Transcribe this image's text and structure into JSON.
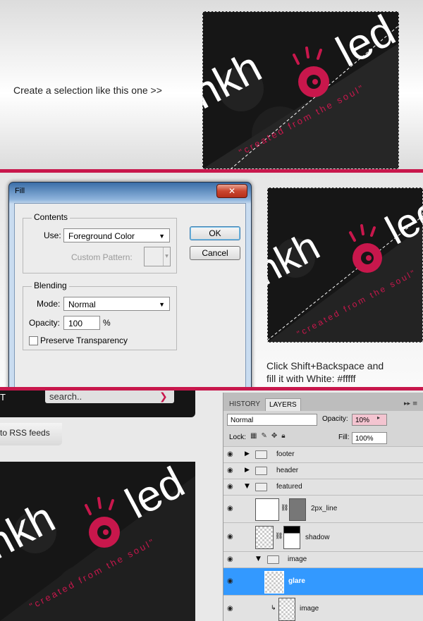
{
  "step1": {
    "instruction": "Create a selection like this one >>"
  },
  "logo": {
    "wordmark_left": "nkh",
    "wordmark_right": "led",
    "tagline": "\"created from the soul\"",
    "accent": "#c8174c"
  },
  "fill_dialog": {
    "title": "Fill",
    "close_glyph": "✕",
    "contents_label": "Contents",
    "use_label": "Use:",
    "use_value": "Foreground Color",
    "custom_pattern_label": "Custom Pattern:",
    "blending_label": "Blending",
    "mode_label": "Mode:",
    "mode_value": "Normal",
    "opacity_label": "Opacity:",
    "opacity_value": "100",
    "opacity_unit": "%",
    "preserve_label": "Preserve Transparency",
    "ok_label": "OK",
    "cancel_label": "Cancel"
  },
  "step2": {
    "instruction_line1": "Click Shift+Backspace and",
    "instruction_line2": "fill it with White: #fffff"
  },
  "site": {
    "nav_fragment": "T",
    "search_placeholder": "search..",
    "rss_link": "to RSS feeds"
  },
  "layers_panel": {
    "tabs": [
      "HISTORY",
      "LAYERS"
    ],
    "blend_mode": "Normal",
    "opacity_label": "Opacity:",
    "opacity_value": "10%",
    "lock_label": "Lock:",
    "fill_label": "Fill:",
    "fill_value": "100%",
    "layers": [
      {
        "name": "footer"
      },
      {
        "name": "header"
      },
      {
        "name": "featured"
      },
      {
        "name": "2px_line"
      },
      {
        "name": "shadow"
      },
      {
        "name": "image"
      },
      {
        "name": "glare"
      },
      {
        "name": "image"
      }
    ],
    "selected_color": "#3399ff"
  }
}
